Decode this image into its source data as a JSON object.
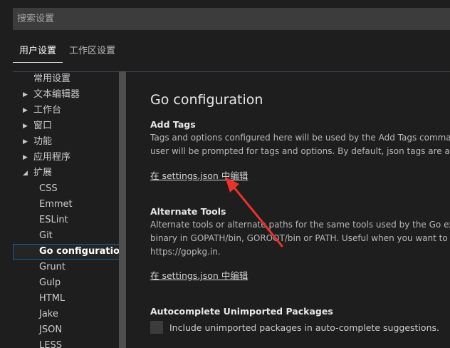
{
  "search": {
    "placeholder": "搜索设置"
  },
  "tabs": [
    {
      "label": "用户设置"
    },
    {
      "label": "工作区设置"
    }
  ],
  "toc": {
    "items": [
      {
        "label": "常用设置",
        "chevron": ""
      },
      {
        "label": "文本编辑器",
        "chevron": "▶"
      },
      {
        "label": "工作台",
        "chevron": "▶"
      },
      {
        "label": "窗口",
        "chevron": "▶"
      },
      {
        "label": "功能",
        "chevron": "▶"
      },
      {
        "label": "应用程序",
        "chevron": "▶"
      },
      {
        "label": "扩展",
        "chevron": "◢"
      }
    ],
    "extensions": [
      {
        "label": "CSS"
      },
      {
        "label": "Emmet"
      },
      {
        "label": "ESLint"
      },
      {
        "label": "Git"
      },
      {
        "label": "Go configuration"
      },
      {
        "label": "Grunt"
      },
      {
        "label": "Gulp"
      },
      {
        "label": "HTML"
      },
      {
        "label": "Jake"
      },
      {
        "label": "JSON"
      },
      {
        "label": "LESS"
      }
    ]
  },
  "main": {
    "group_title": "Go configuration",
    "settings": [
      {
        "title": "Add Tags",
        "desc_lines": [
          "Tags and options configured here will be used by the Add Tags command",
          "user will be prompted for tags and options. By default, json tags are adde"
        ],
        "link": "在 settings.json 中编辑"
      },
      {
        "title": "Alternate Tools",
        "desc_lines": [
          "Alternate tools or alternate paths for the same tools used by the Go exten",
          "binary in GOPATH/bin, GOROOT/bin or PATH. Useful when you want to us",
          "https://gopkg.in."
        ],
        "link": "在 settings.json 中编辑"
      },
      {
        "title": "Autocomplete Unimported Packages",
        "checkbox_label": "Include unimported packages in auto-complete suggestions.",
        "checked": false
      }
    ]
  },
  "colors": {
    "background": "#1e1e1e",
    "input_background": "#3c3c3c",
    "selection_border": "#0e639c",
    "arrow": "#e8322b"
  }
}
